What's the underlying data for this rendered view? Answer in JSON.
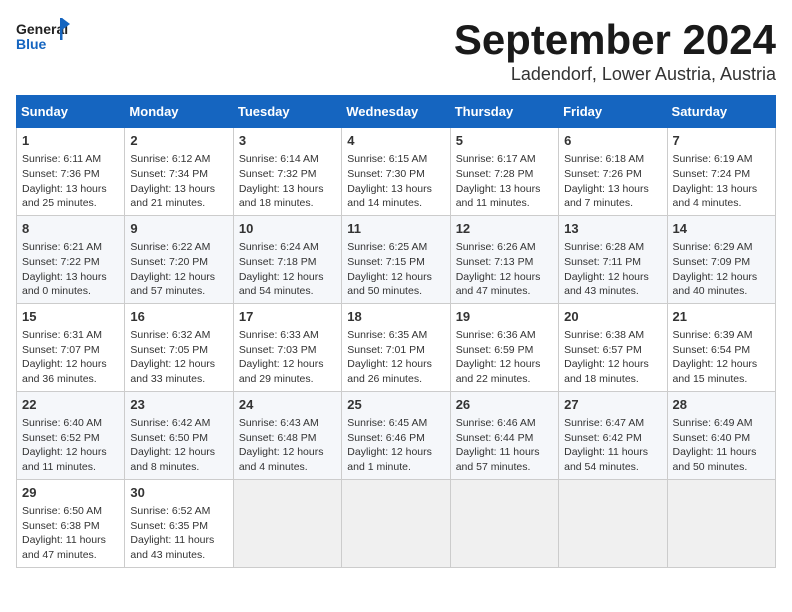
{
  "header": {
    "logo_text_general": "General",
    "logo_text_blue": "Blue",
    "month": "September 2024",
    "location": "Ladendorf, Lower Austria, Austria"
  },
  "columns": [
    "Sunday",
    "Monday",
    "Tuesday",
    "Wednesday",
    "Thursday",
    "Friday",
    "Saturday"
  ],
  "weeks": [
    [
      {
        "day": "1",
        "sunrise": "Sunrise: 6:11 AM",
        "sunset": "Sunset: 7:36 PM",
        "daylight": "Daylight: 13 hours and 25 minutes."
      },
      {
        "day": "2",
        "sunrise": "Sunrise: 6:12 AM",
        "sunset": "Sunset: 7:34 PM",
        "daylight": "Daylight: 13 hours and 21 minutes."
      },
      {
        "day": "3",
        "sunrise": "Sunrise: 6:14 AM",
        "sunset": "Sunset: 7:32 PM",
        "daylight": "Daylight: 13 hours and 18 minutes."
      },
      {
        "day": "4",
        "sunrise": "Sunrise: 6:15 AM",
        "sunset": "Sunset: 7:30 PM",
        "daylight": "Daylight: 13 hours and 14 minutes."
      },
      {
        "day": "5",
        "sunrise": "Sunrise: 6:17 AM",
        "sunset": "Sunset: 7:28 PM",
        "daylight": "Daylight: 13 hours and 11 minutes."
      },
      {
        "day": "6",
        "sunrise": "Sunrise: 6:18 AM",
        "sunset": "Sunset: 7:26 PM",
        "daylight": "Daylight: 13 hours and 7 minutes."
      },
      {
        "day": "7",
        "sunrise": "Sunrise: 6:19 AM",
        "sunset": "Sunset: 7:24 PM",
        "daylight": "Daylight: 13 hours and 4 minutes."
      }
    ],
    [
      {
        "day": "8",
        "sunrise": "Sunrise: 6:21 AM",
        "sunset": "Sunset: 7:22 PM",
        "daylight": "Daylight: 13 hours and 0 minutes."
      },
      {
        "day": "9",
        "sunrise": "Sunrise: 6:22 AM",
        "sunset": "Sunset: 7:20 PM",
        "daylight": "Daylight: 12 hours and 57 minutes."
      },
      {
        "day": "10",
        "sunrise": "Sunrise: 6:24 AM",
        "sunset": "Sunset: 7:18 PM",
        "daylight": "Daylight: 12 hours and 54 minutes."
      },
      {
        "day": "11",
        "sunrise": "Sunrise: 6:25 AM",
        "sunset": "Sunset: 7:15 PM",
        "daylight": "Daylight: 12 hours and 50 minutes."
      },
      {
        "day": "12",
        "sunrise": "Sunrise: 6:26 AM",
        "sunset": "Sunset: 7:13 PM",
        "daylight": "Daylight: 12 hours and 47 minutes."
      },
      {
        "day": "13",
        "sunrise": "Sunrise: 6:28 AM",
        "sunset": "Sunset: 7:11 PM",
        "daylight": "Daylight: 12 hours and 43 minutes."
      },
      {
        "day": "14",
        "sunrise": "Sunrise: 6:29 AM",
        "sunset": "Sunset: 7:09 PM",
        "daylight": "Daylight: 12 hours and 40 minutes."
      }
    ],
    [
      {
        "day": "15",
        "sunrise": "Sunrise: 6:31 AM",
        "sunset": "Sunset: 7:07 PM",
        "daylight": "Daylight: 12 hours and 36 minutes."
      },
      {
        "day": "16",
        "sunrise": "Sunrise: 6:32 AM",
        "sunset": "Sunset: 7:05 PM",
        "daylight": "Daylight: 12 hours and 33 minutes."
      },
      {
        "day": "17",
        "sunrise": "Sunrise: 6:33 AM",
        "sunset": "Sunset: 7:03 PM",
        "daylight": "Daylight: 12 hours and 29 minutes."
      },
      {
        "day": "18",
        "sunrise": "Sunrise: 6:35 AM",
        "sunset": "Sunset: 7:01 PM",
        "daylight": "Daylight: 12 hours and 26 minutes."
      },
      {
        "day": "19",
        "sunrise": "Sunrise: 6:36 AM",
        "sunset": "Sunset: 6:59 PM",
        "daylight": "Daylight: 12 hours and 22 minutes."
      },
      {
        "day": "20",
        "sunrise": "Sunrise: 6:38 AM",
        "sunset": "Sunset: 6:57 PM",
        "daylight": "Daylight: 12 hours and 18 minutes."
      },
      {
        "day": "21",
        "sunrise": "Sunrise: 6:39 AM",
        "sunset": "Sunset: 6:54 PM",
        "daylight": "Daylight: 12 hours and 15 minutes."
      }
    ],
    [
      {
        "day": "22",
        "sunrise": "Sunrise: 6:40 AM",
        "sunset": "Sunset: 6:52 PM",
        "daylight": "Daylight: 12 hours and 11 minutes."
      },
      {
        "day": "23",
        "sunrise": "Sunrise: 6:42 AM",
        "sunset": "Sunset: 6:50 PM",
        "daylight": "Daylight: 12 hours and 8 minutes."
      },
      {
        "day": "24",
        "sunrise": "Sunrise: 6:43 AM",
        "sunset": "Sunset: 6:48 PM",
        "daylight": "Daylight: 12 hours and 4 minutes."
      },
      {
        "day": "25",
        "sunrise": "Sunrise: 6:45 AM",
        "sunset": "Sunset: 6:46 PM",
        "daylight": "Daylight: 12 hours and 1 minute."
      },
      {
        "day": "26",
        "sunrise": "Sunrise: 6:46 AM",
        "sunset": "Sunset: 6:44 PM",
        "daylight": "Daylight: 11 hours and 57 minutes."
      },
      {
        "day": "27",
        "sunrise": "Sunrise: 6:47 AM",
        "sunset": "Sunset: 6:42 PM",
        "daylight": "Daylight: 11 hours and 54 minutes."
      },
      {
        "day": "28",
        "sunrise": "Sunrise: 6:49 AM",
        "sunset": "Sunset: 6:40 PM",
        "daylight": "Daylight: 11 hours and 50 minutes."
      }
    ],
    [
      {
        "day": "29",
        "sunrise": "Sunrise: 6:50 AM",
        "sunset": "Sunset: 6:38 PM",
        "daylight": "Daylight: 11 hours and 47 minutes."
      },
      {
        "day": "30",
        "sunrise": "Sunrise: 6:52 AM",
        "sunset": "Sunset: 6:35 PM",
        "daylight": "Daylight: 11 hours and 43 minutes."
      },
      null,
      null,
      null,
      null,
      null
    ]
  ]
}
